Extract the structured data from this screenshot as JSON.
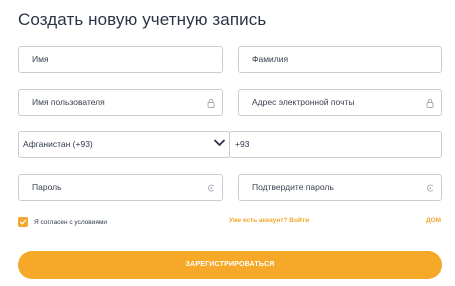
{
  "form": {
    "title": "Создать новую учетную запись",
    "first_name_placeholder": "Имя",
    "last_name_placeholder": "Фамилия",
    "username_placeholder": "Имя пользователя",
    "email_placeholder": "Адрес электронной почты",
    "country_selected": "Афганистан (+93)",
    "phone_value": "+93",
    "password_placeholder": "Пароль",
    "confirm_password_placeholder": "Подтвердите пароль",
    "agree_label": "Я согласен с условиями",
    "agree_checked": true,
    "login_link": "Уже есть аккаунт? Войти",
    "home_link": "ДОМ",
    "submit_label": "ЗАРЕГИСТРИРОВАТЬСЯ"
  },
  "icons": {
    "username": "lock-icon",
    "email": "lock-icon",
    "country": "chevron-down-icon",
    "password": "eye-icon",
    "confirm_password": "eye-icon",
    "agree": "check-icon"
  },
  "colors": {
    "accent": "#f6a928",
    "border": "#c9ccd3",
    "text": "#2f3a4d"
  }
}
